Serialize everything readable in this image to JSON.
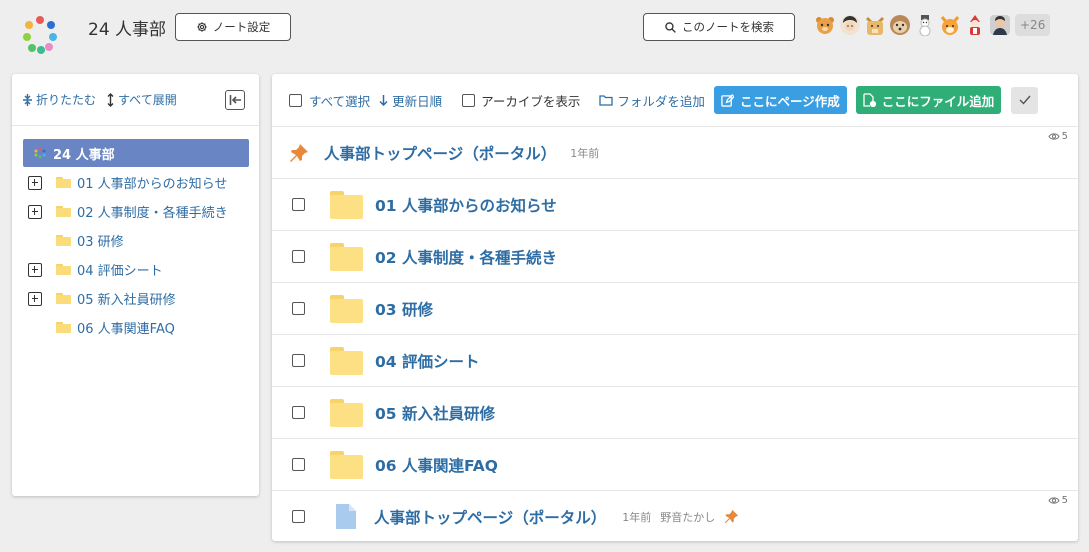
{
  "header": {
    "note_title": "24 人事部",
    "settings_label": "ノート設定",
    "search_label": "このノートを検索",
    "members_more": "+26",
    "member_avatars": [
      "bear-icon",
      "person-icon",
      "cat-icon",
      "dog-icon",
      "snowman-icon",
      "fox-icon",
      "doll-icon",
      "person-icon"
    ]
  },
  "sidebar": {
    "collapse_label": "折りたたむ",
    "expand_label": "すべて展開",
    "items": [
      {
        "label": "24 人事部",
        "active": true
      },
      {
        "label": "01 人事部からのお知らせ",
        "expandable": true
      },
      {
        "label": "02 人事制度・各種手続き",
        "expandable": true
      },
      {
        "label": "03 研修",
        "expandable": false
      },
      {
        "label": "04 評価シート",
        "expandable": true
      },
      {
        "label": "05 新入社員研修",
        "expandable": true
      },
      {
        "label": "06 人事関連FAQ",
        "expandable": false
      }
    ]
  },
  "toolbar": {
    "select_all": "すべて選択",
    "sort": "更新日順",
    "show_archive": "アーカイブを表示",
    "add_folder": "フォルダを追加",
    "create_page": "ここにページ作成",
    "add_file": "ここにファイル追加"
  },
  "pinned": {
    "title": "人事部トップページ（ポータル）",
    "time": "1年前",
    "views": "5"
  },
  "folders": [
    {
      "label": "01 人事部からのお知らせ"
    },
    {
      "label": "02 人事制度・各種手続き"
    },
    {
      "label": "03 研修"
    },
    {
      "label": "04 評価シート"
    },
    {
      "label": "05 新入社員研修"
    },
    {
      "label": "06 人事関連FAQ"
    }
  ],
  "page_item": {
    "title": "人事部トップページ（ポータル）",
    "time": "1年前",
    "author": "野音たかし",
    "views": "5"
  },
  "colors": {
    "accent_blue": "#2e6da4",
    "active_tree": "#6a85c4",
    "create_page_button": "#3a9ee3",
    "add_file_button": "#2fae78",
    "folder": "#fce083",
    "pin": "#e8883a"
  }
}
